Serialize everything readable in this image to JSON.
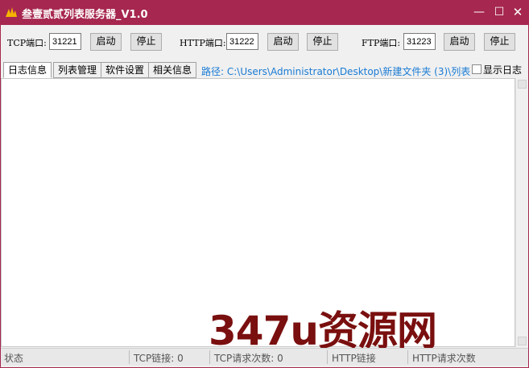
{
  "window": {
    "title": "叁壹贰贰列表服务器_V1.0",
    "controls": {
      "minimize": "—",
      "maximize": "☐",
      "close": "✕"
    }
  },
  "ports": {
    "tcp": {
      "label": "TCP端口:",
      "value": "31221",
      "start": "启动",
      "stop": "停止"
    },
    "http": {
      "label": "HTTP端口:",
      "value": "31222",
      "start": "启动",
      "stop": "停止"
    },
    "ftp": {
      "label": "FTP端口:",
      "value": "31223",
      "start": "启动",
      "stop": "停止"
    }
  },
  "tabs": [
    "日志信息",
    "列表管理",
    "软件设置",
    "相关信息"
  ],
  "path": "路径: C:\\Users\\Administrator\\Desktop\\新建文件夹 (3)\\列表",
  "show_log": {
    "label": "显示日志",
    "checked": false
  },
  "log_lines": [],
  "status": {
    "state": "状态",
    "tcp_conn": "TCP链接: 0",
    "tcp_req": "TCP请求次数: 0",
    "http_conn": "HTTP链接",
    "http_req": "HTTP请求次数"
  },
  "watermark": "347u资源网",
  "colors": {
    "titlebar": "#a6274f",
    "path_text": "#1a7bd4",
    "watermark": "#7a0f0f"
  }
}
